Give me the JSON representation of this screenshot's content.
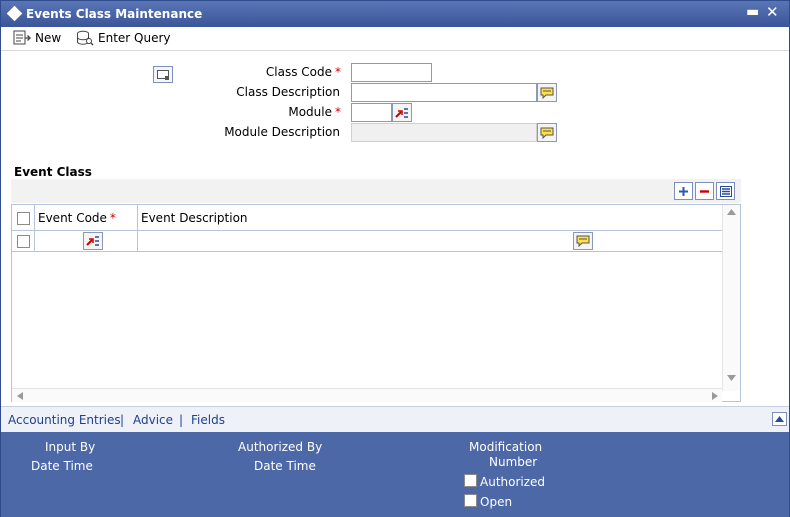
{
  "window": {
    "title": "Events Class Maintenance",
    "minimize": "▬",
    "close": "✕"
  },
  "toolbar": {
    "new_label": "New",
    "enter_query_label": "Enter Query"
  },
  "form": {
    "class_code_label": "Class Code",
    "class_description_label": "Class Description",
    "module_label": "Module",
    "module_description_label": "Module Description",
    "required_mark": "*",
    "class_code_value": "",
    "class_description_value": "",
    "module_value": "",
    "module_description_value": ""
  },
  "event_class": {
    "section_title": "Event Class",
    "columns": [
      "Event Code",
      "Event Description"
    ],
    "rows": [
      {
        "event_code": "",
        "event_description": ""
      }
    ]
  },
  "links": [
    "Accounting Entries",
    "Advice",
    "Fields"
  ],
  "link_separator": "|",
  "footer": {
    "input_by": "Input By",
    "date_time_1": "Date Time",
    "authorized_by": "Authorized By",
    "date_time_2": "Date Time",
    "modification": "Modification",
    "number": "Number",
    "authorized": "Authorized",
    "open": "Open"
  },
  "colors": {
    "titlebar": "#3a5699",
    "footer": "#4d68a6",
    "link": "#1f3f8f",
    "required": "#cc0000"
  }
}
